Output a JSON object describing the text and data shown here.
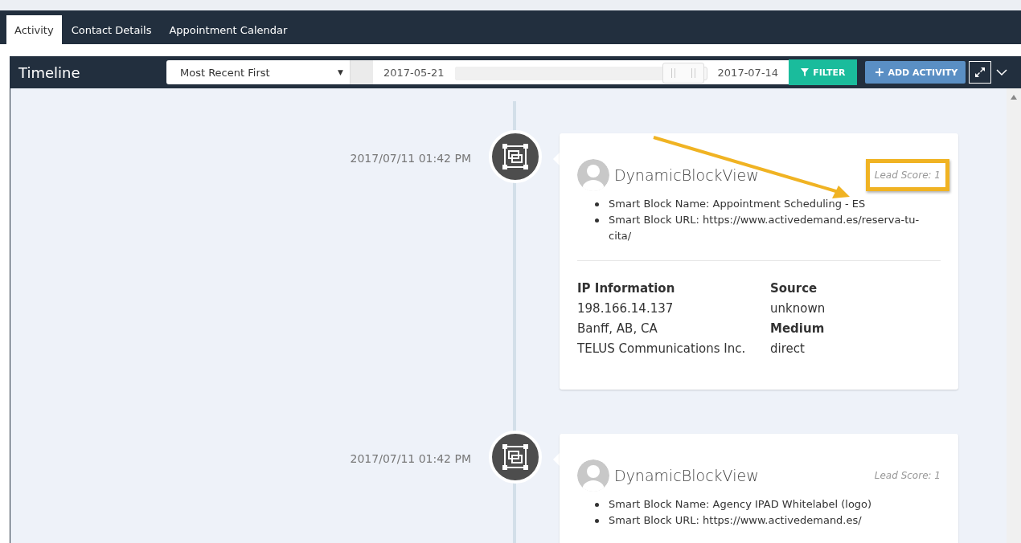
{
  "tabs": [
    {
      "label": "Activity",
      "selected": true
    },
    {
      "label": "Contact Details",
      "selected": false
    },
    {
      "label": "Appointment Calendar",
      "selected": false
    }
  ],
  "timeline": {
    "title": "Timeline",
    "sort": "Most Recent First",
    "sort_caret": "▼",
    "date_from": "2017-05-21",
    "date_to": "2017-07-14",
    "range": {
      "level": 0.83
    },
    "filter_button": "FILTER",
    "add_button": "ADD ACTIVITY"
  },
  "entries": [
    {
      "time": "2017/07/11 01:42 PM",
      "title": "DynamicBlockView",
      "lead_score": "Lead Score: 1",
      "highlighted": true,
      "bullets": [
        "Smart Block Name: Appointment Scheduling - ES",
        "Smart Block URL: https://www.activedemand.es/reserva-tu-cita/"
      ],
      "details": [
        {
          "label": "IP Information",
          "lines": [
            "198.166.14.137",
            "Banff, AB, CA",
            "TELUS Communications Inc."
          ]
        },
        {
          "label": "Source",
          "lines": [
            "unknown"
          ]
        },
        {
          "label": "Medium",
          "lines": [
            "direct"
          ]
        }
      ]
    },
    {
      "time": "2017/07/11 01:42 PM",
      "title": "DynamicBlockView",
      "lead_score": "Lead Score: 1",
      "highlighted": false,
      "bullets": [
        "Smart Block Name: Agency IPAD Whitelabel (logo)",
        "Smart Block URL: https://www.activedemand.es/"
      ]
    }
  ]
}
